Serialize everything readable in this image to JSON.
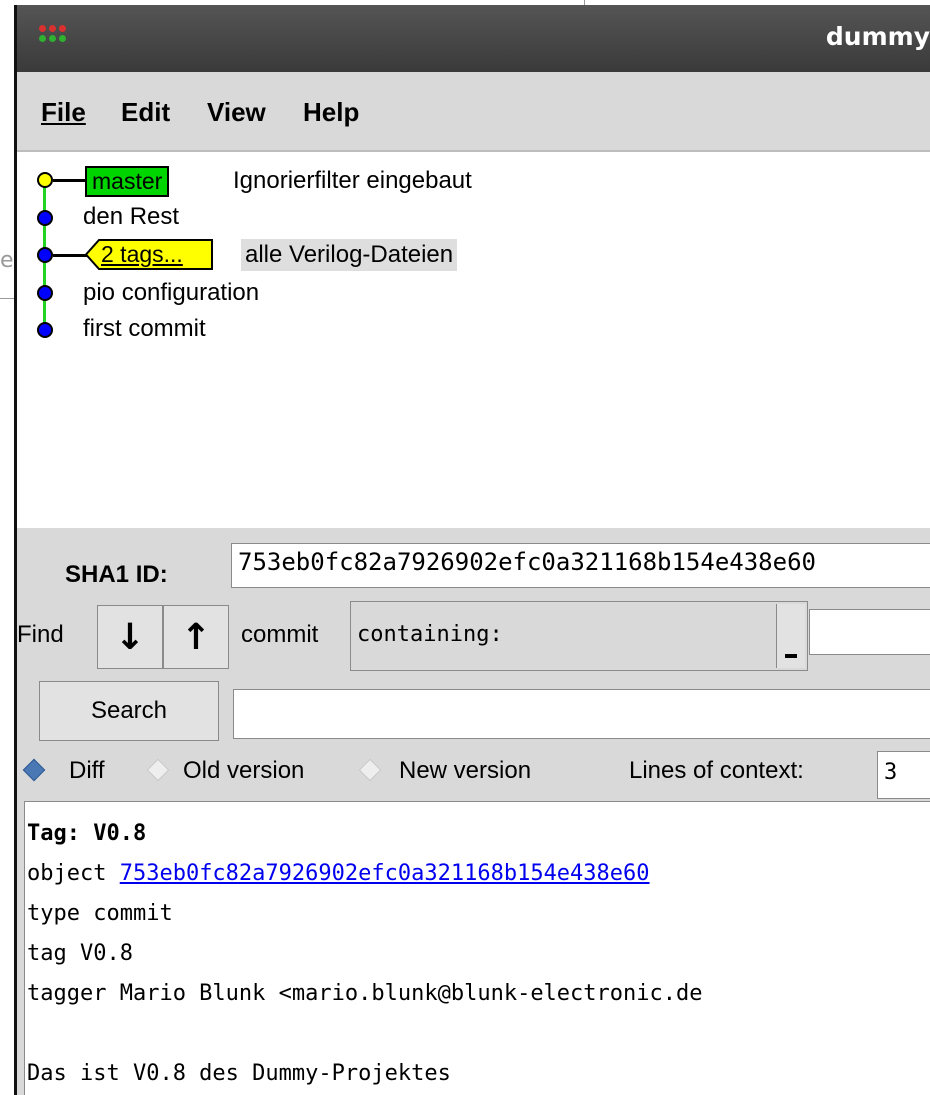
{
  "window": {
    "title": "dummy"
  },
  "background_window": {
    "text": "e"
  },
  "menu": {
    "file": "File",
    "edit": "Edit",
    "view": "View",
    "help": "Help"
  },
  "commits": [
    {
      "message": "Ignorierfilter eingebaut",
      "ref_branch": "master",
      "head": true
    },
    {
      "message": "den Rest"
    },
    {
      "message": "alle Verilog-Dateien",
      "ref_tags": "2 tags...",
      "selected": true
    },
    {
      "message": "pio configuration"
    },
    {
      "message": "first commit"
    }
  ],
  "sha": {
    "label": "SHA1 ID:",
    "value": "753eb0fc82a7926902efc0a321168b154e438e60"
  },
  "find": {
    "label": "Find",
    "down_icon": "arrow-down-icon",
    "up_icon": "arrow-up-icon",
    "type_label": "commit",
    "mode_value": "containing:",
    "query": ""
  },
  "search": {
    "button": "Search",
    "query": ""
  },
  "view_mode": {
    "diff": "Diff",
    "old_version": "Old version",
    "new_version": "New version",
    "selected": "Diff",
    "context_label": "Lines of context:",
    "context_value": "3"
  },
  "details": {
    "tag_line": "Tag: V0.8",
    "object_prefix": "object ",
    "object_hash": "753eb0fc82a7926902efc0a321168b154e438e60",
    "type_line": "type commit",
    "tag_name_line": "tag V0.8",
    "tagger_line": "tagger Mario Blunk <mario.blunk@blunk-electronic.de",
    "blank_line": "",
    "message_line": "Das ist V0.8 des Dummy-Projektes"
  },
  "colors": {
    "branch_ref": "#00d500",
    "tag_ref": "#ffff00",
    "rail": "#22d322",
    "head_node": "#ffff00",
    "commit_node": "#0000ff",
    "link": "#0000ee",
    "radio_selected": "#4a78b4"
  }
}
